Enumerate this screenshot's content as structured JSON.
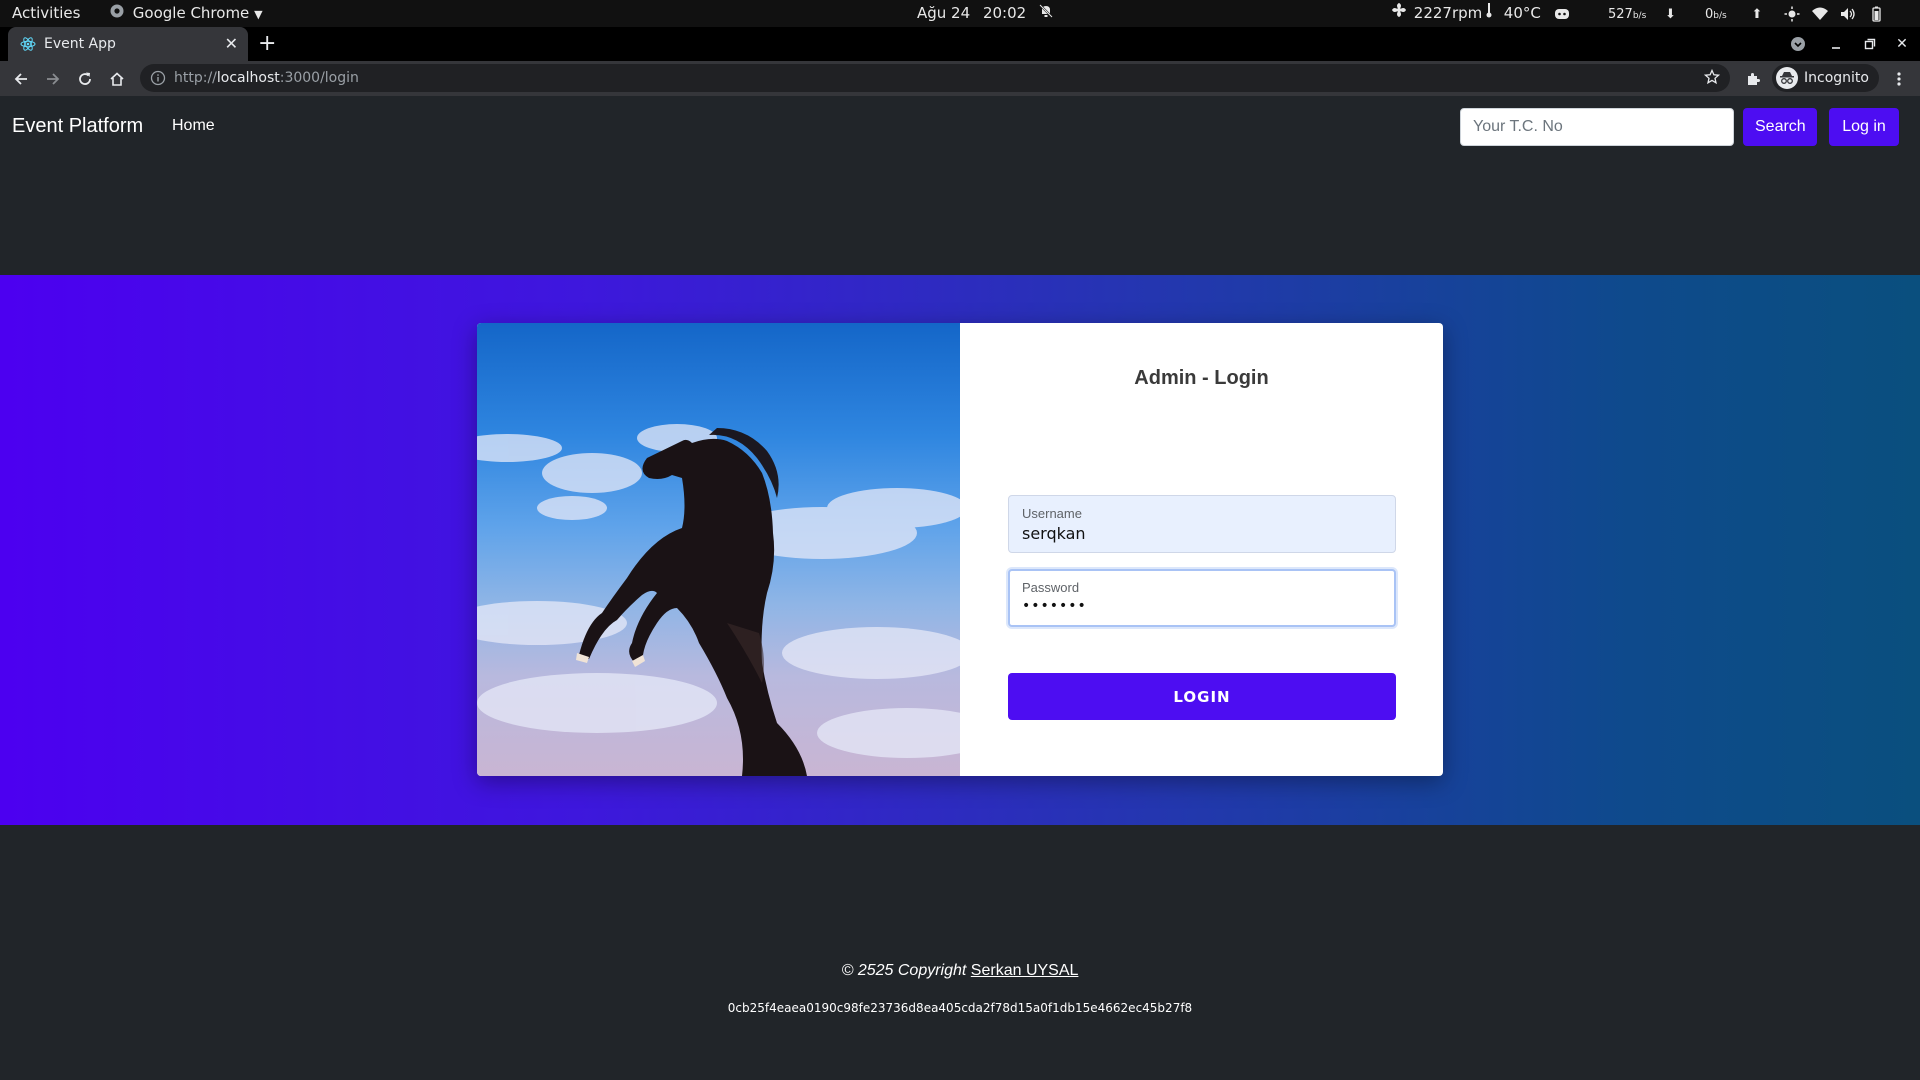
{
  "os_bar": {
    "activities": "Activities",
    "app_name": "Google Chrome",
    "date": "Ağu 24",
    "time": "20:02",
    "fan": "2227rpm",
    "temp": "40°C",
    "net_down_value": "527",
    "net_down_unit": "b/s",
    "net_up_value": "0",
    "net_up_unit": "b/s"
  },
  "browser": {
    "tab_title": "Event App",
    "url_scheme": "http://",
    "url_host": "localhost",
    "url_path": ":3000/login",
    "profile_label": "Incognito"
  },
  "navbar": {
    "brand": "Event Platform",
    "home": "Home",
    "search_placeholder": "Your T.C. No",
    "search_button": "Search",
    "login_button": "Log in"
  },
  "login_card": {
    "title": "Admin - Login",
    "username_label": "Username",
    "username_value": "serqkan",
    "password_label": "Password",
    "password_value": "•••••••",
    "submit": "LOGIN"
  },
  "footer": {
    "copyright_prefix": "© 2525 Copyright",
    "author": "Serkan UYSAL",
    "hash": "0cb25f4eaea0190c98fe23736d8ea405cda2f78d15a0f1db15e4662ec45b27f8"
  },
  "colors": {
    "accent": "#4d0df2",
    "page_background": "#212529",
    "hero_gradient_start": "#4c00f0",
    "hero_gradient_end": "#0a4f7e"
  }
}
